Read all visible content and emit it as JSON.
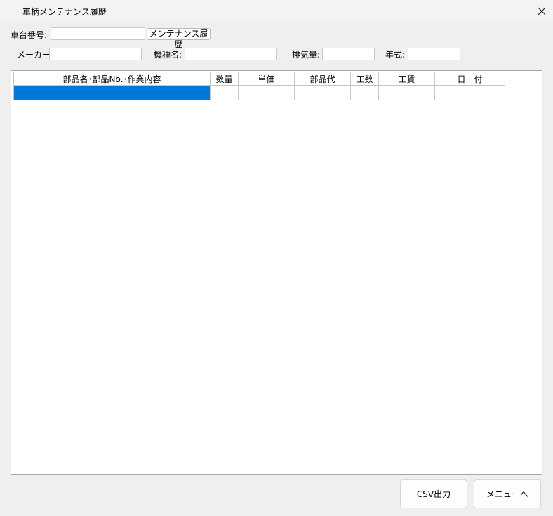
{
  "window": {
    "title": "車柄メンテナンス履歴"
  },
  "form": {
    "vehicle_no_label": "車台番号:",
    "vehicle_no_value": "",
    "history_button": "メンテナンス履歴",
    "maker_label": "メーカー:",
    "maker_value": "",
    "model_label": "機種名:",
    "model_value": "",
    "displacement_label": "排気量:",
    "displacement_value": "",
    "year_label": "年式:",
    "year_value": ""
  },
  "grid": {
    "headers": [
      "部品名･部品No.･作業内容",
      "数量",
      "単価",
      "部品代",
      "工数",
      "工賃",
      "日　付"
    ],
    "rows": [
      [
        "",
        "",
        "",
        "",
        "",
        "",
        ""
      ]
    ]
  },
  "footer": {
    "csv_button": "CSV出力",
    "menu_button": "メニューへ"
  },
  "colors": {
    "selection": "#0078d7"
  }
}
